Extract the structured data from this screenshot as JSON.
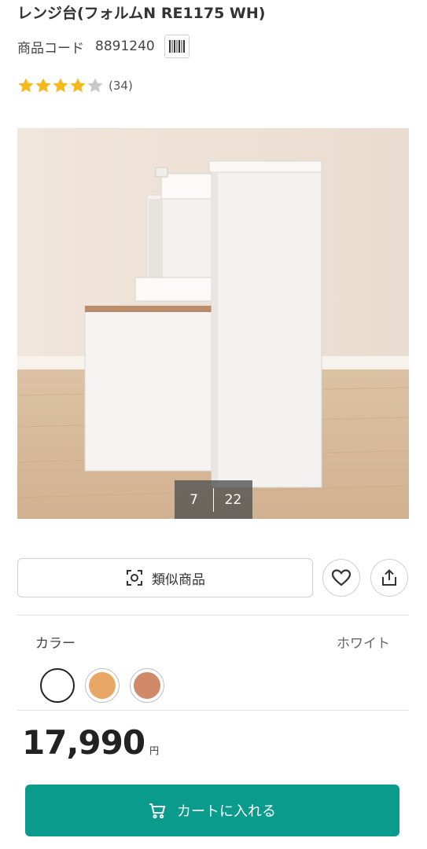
{
  "product": {
    "title": "レンジ台(フォルムN RE1175 WH)",
    "code_label": "商品コード",
    "code_value": "8891240",
    "rating": 4,
    "rating_max": 5,
    "review_count": "(34)"
  },
  "gallery": {
    "current": "7",
    "total": "22"
  },
  "actions": {
    "similar_label": "類似商品"
  },
  "color": {
    "label": "カラー",
    "selected_name": "ホワイト",
    "swatches": [
      "#ffffff",
      "#e8a765",
      "#d08a6a"
    ]
  },
  "price": {
    "amount": "17,990",
    "unit": "円"
  },
  "cart": {
    "label": "カートに入れる"
  },
  "colors": {
    "accent": "#0a9b8d",
    "star_filled": "#f6b91b",
    "star_empty": "#c8c8c8"
  }
}
